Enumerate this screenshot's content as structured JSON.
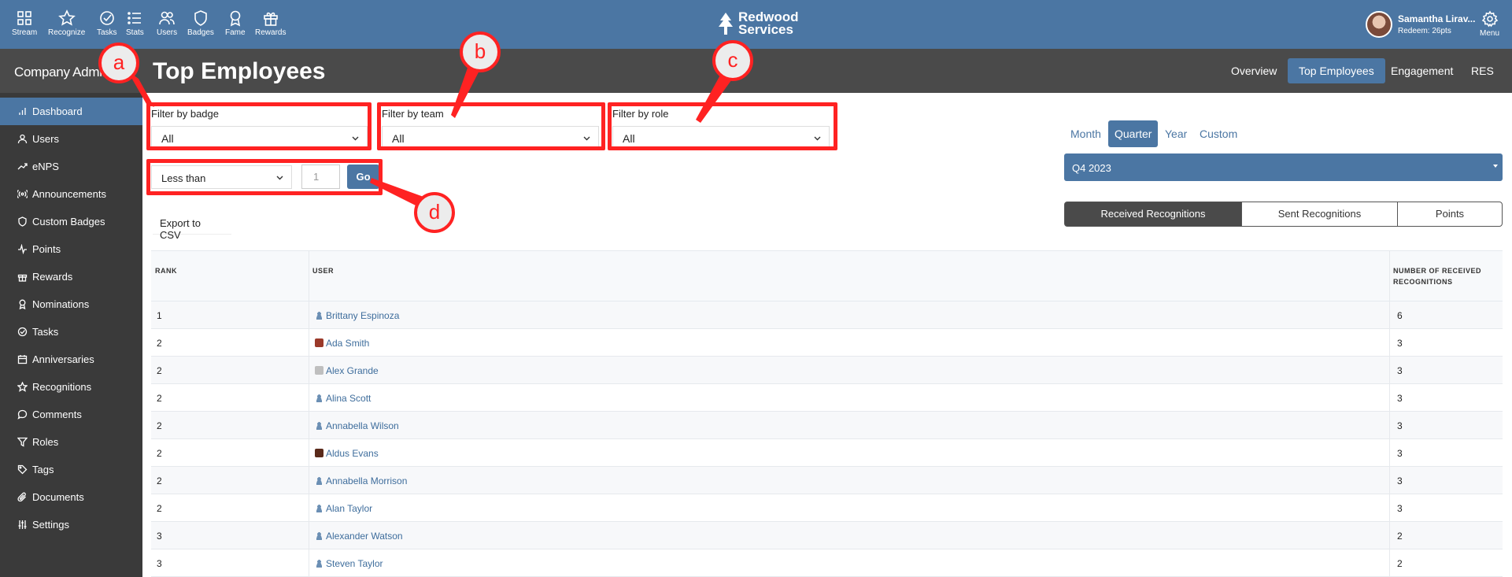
{
  "topnav": {
    "items": [
      {
        "label": "Stream",
        "icon": "grid-icon"
      },
      {
        "label": "Recognize",
        "icon": "star-icon"
      },
      {
        "label": "Tasks",
        "icon": "check-circle-icon"
      },
      {
        "label": "Stats",
        "icon": "list-icon"
      },
      {
        "label": "Users",
        "icon": "users-icon"
      },
      {
        "label": "Badges",
        "icon": "shield-icon"
      },
      {
        "label": "Fame",
        "icon": "award-icon"
      },
      {
        "label": "Rewards",
        "icon": "gift-icon"
      }
    ],
    "brand_line1": "Redwood",
    "brand_line2": "Services",
    "user_name": "Samantha Lirav...",
    "user_points": "Redeem: 26pts",
    "menu_label": "Menu"
  },
  "header": {
    "admin_title": "Company Admin",
    "page_title": "Top Employees",
    "tabs": [
      "Overview",
      "Top Employees",
      "Engagement",
      "RES"
    ],
    "active_tab": "Top Employees"
  },
  "sidebar": {
    "items": [
      {
        "label": "Dashboard",
        "icon": "bar-chart-icon"
      },
      {
        "label": "Users",
        "icon": "user-icon"
      },
      {
        "label": "eNPS",
        "icon": "trend-icon"
      },
      {
        "label": "Announcements",
        "icon": "broadcast-icon"
      },
      {
        "label": "Custom Badges",
        "icon": "shield-icon"
      },
      {
        "label": "Points",
        "icon": "pulse-icon"
      },
      {
        "label": "Rewards",
        "icon": "gift-icon"
      },
      {
        "label": "Nominations",
        "icon": "award-icon"
      },
      {
        "label": "Tasks",
        "icon": "check-circle-icon"
      },
      {
        "label": "Anniversaries",
        "icon": "calendar-icon"
      },
      {
        "label": "Recognitions",
        "icon": "star-icon"
      },
      {
        "label": "Comments",
        "icon": "comment-icon"
      },
      {
        "label": "Roles",
        "icon": "filter-icon"
      },
      {
        "label": "Tags",
        "icon": "tag-icon"
      },
      {
        "label": "Documents",
        "icon": "paperclip-icon"
      },
      {
        "label": "Settings",
        "icon": "sliders-icon"
      }
    ],
    "active": "Dashboard"
  },
  "filters": {
    "badge_label": "Filter by badge",
    "badge_value": "All",
    "team_label": "Filter by team",
    "team_value": "All",
    "role_label": "Filter by role",
    "role_value": "All",
    "comparison_value": "Less than",
    "count_placeholder": "1",
    "go_label": "Go",
    "export_label": "Export to CSV"
  },
  "period": {
    "options": [
      "Month",
      "Quarter",
      "Year",
      "Custom"
    ],
    "active": "Quarter",
    "selected_quarter": "Q4 2023",
    "segments": [
      "Received Recognitions",
      "Sent Recognitions",
      "Points"
    ],
    "active_segment": "Received Recognitions"
  },
  "table": {
    "headers": {
      "rank": "RANK",
      "user": "USER",
      "count_line1": "NUMBER OF RECEIVED",
      "count_line2": "RECOGNITIONS"
    },
    "rows": [
      {
        "rank": "1",
        "user": "Brittany Espinoza",
        "count": "6",
        "avatar": "default"
      },
      {
        "rank": "2",
        "user": "Ada Smith",
        "count": "3",
        "avatar": "photo"
      },
      {
        "rank": "2",
        "user": "Alex Grande",
        "count": "3",
        "avatar": "photo2"
      },
      {
        "rank": "2",
        "user": "Alina Scott",
        "count": "3",
        "avatar": "default"
      },
      {
        "rank": "2",
        "user": "Annabella Wilson",
        "count": "3",
        "avatar": "default"
      },
      {
        "rank": "2",
        "user": "Aldus Evans",
        "count": "3",
        "avatar": "photo3"
      },
      {
        "rank": "2",
        "user": "Annabella Morrison",
        "count": "3",
        "avatar": "default"
      },
      {
        "rank": "2",
        "user": "Alan Taylor",
        "count": "3",
        "avatar": "default"
      },
      {
        "rank": "3",
        "user": "Alexander Watson",
        "count": "2",
        "avatar": "default"
      },
      {
        "rank": "3",
        "user": "Steven Taylor",
        "count": "2",
        "avatar": "default"
      }
    ]
  },
  "annotations": [
    "a",
    "b",
    "c",
    "d"
  ],
  "colors": {
    "primary": "#4b76a3",
    "header_dark": "#4a4a4a",
    "sidebar": "#3a3a3a",
    "annotation_red": "#ff2222"
  }
}
